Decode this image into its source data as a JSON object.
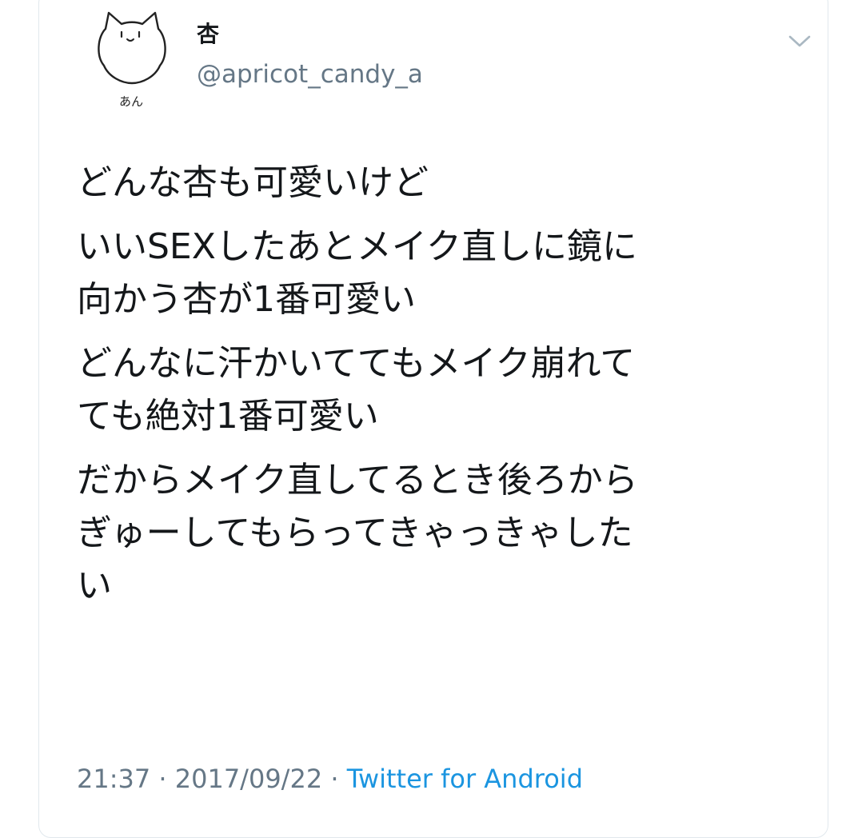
{
  "user": {
    "display_name": "杏",
    "handle": "@apricot_candy_a",
    "avatar_caption": "あん",
    "avatar_icon": "cat-doodle-avatar"
  },
  "menu": {
    "icon": "chevron-down-icon"
  },
  "tweet": {
    "paragraphs": [
      "どんな杏も可愛いけど",
      "いいSEXしたあとメイク直しに鏡に\n向かう杏が1番可愛い",
      "どんなに汗かいててもメイク崩れて\nても絶対1番可愛い",
      "だからメイク直してるとき後ろから\nぎゅーしてもらってきゃっきゃした\nい"
    ],
    "time": "21:37",
    "date": "2017/09/22",
    "separator": "·",
    "source": "Twitter for Android"
  },
  "colors": {
    "text": "#14171a",
    "secondary": "#657786",
    "link": "#1b95e0",
    "border": "#e1e8ed"
  }
}
